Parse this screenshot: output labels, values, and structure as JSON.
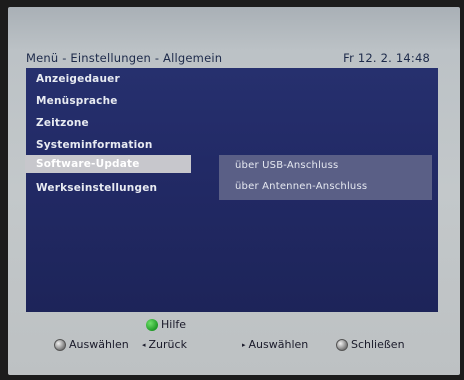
{
  "header": {
    "title": "Menü - Einstellungen - Allgemein",
    "datetime": "Fr 12. 2.  14:48"
  },
  "menu": {
    "items": [
      {
        "label": "Anzeigedauer"
      },
      {
        "label": "Menüsprache"
      },
      {
        "label": "Zeitzone"
      },
      {
        "label": "Systeminformation"
      },
      {
        "label": "Software-Update"
      },
      {
        "label": "Werkseinstellungen"
      }
    ],
    "selected": "Software-Update"
  },
  "submenu": {
    "items": [
      {
        "label": "über USB-Anschluss"
      },
      {
        "label": "über Antennen-Anschluss"
      }
    ]
  },
  "footer": {
    "help": {
      "label": "Hilfe",
      "icon": "green-button-icon"
    },
    "select_ok": {
      "label": "Auswählen",
      "icon": "ok-button-icon"
    },
    "back": {
      "label": "Zurück",
      "icon": "left-arrow-icon"
    },
    "select_right": {
      "label": "Auswählen",
      "icon": "right-arrow-icon"
    },
    "close": {
      "label": "Schließen",
      "icon": "exit-button-icon"
    }
  },
  "colors": {
    "panel": "#232c69",
    "highlight": "#c7c7cc",
    "submenu": "#5a5f86",
    "frame": "#c3c8ca"
  }
}
